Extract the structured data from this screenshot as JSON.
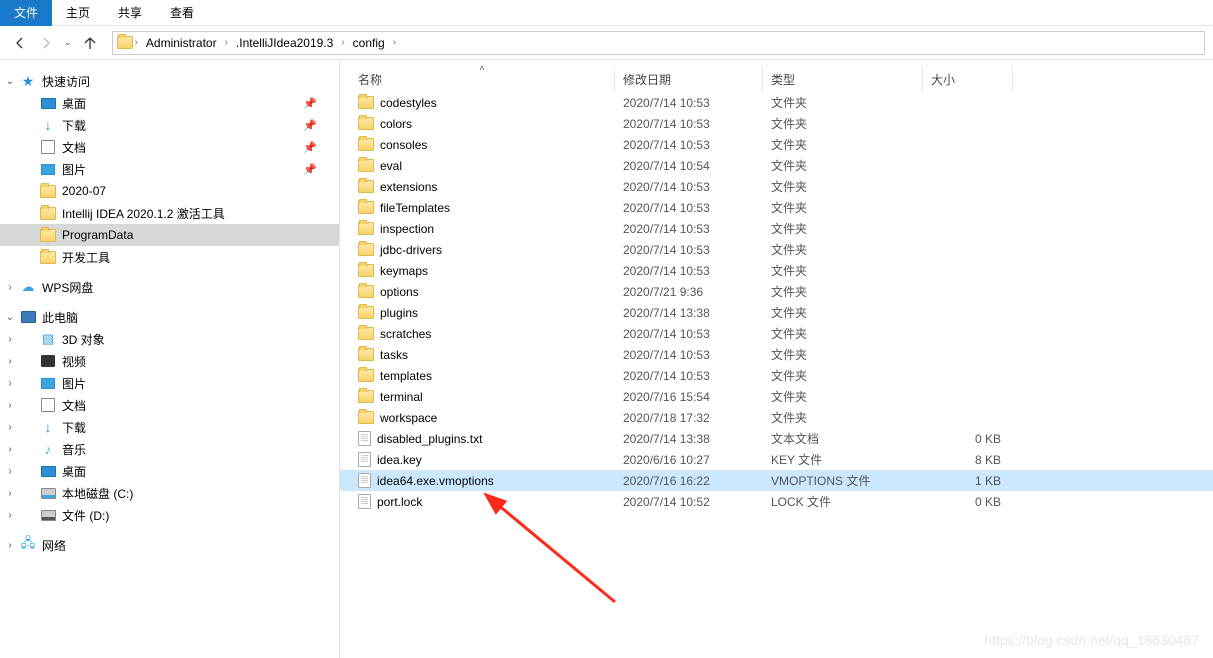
{
  "menu": {
    "file": "文件",
    "home": "主页",
    "share": "共享",
    "view": "查看"
  },
  "breadcrumb": [
    "Administrator",
    ".IntelliJIdea2019.3",
    "config"
  ],
  "sidebar": {
    "quick": "快速访问",
    "desktop": "桌面",
    "downloads": "下载",
    "documents": "文档",
    "pictures": "图片",
    "f_2020_07": "2020-07",
    "f_intellij": "Intellij IDEA 2020.1.2 激活工具",
    "f_programdata": "ProgramData",
    "f_devtools": "开发工具",
    "wps": "WPS网盘",
    "thispc": "此电脑",
    "obj3d": "3D 对象",
    "videos": "视频",
    "pictures2": "图片",
    "documents2": "文档",
    "downloads2": "下载",
    "music": "音乐",
    "desktop2": "桌面",
    "diskc": "本地磁盘 (C:)",
    "diskd": "文件 (D:)",
    "network": "网络"
  },
  "columns": {
    "name": "名称",
    "date": "修改日期",
    "type": "类型",
    "size": "大小"
  },
  "rows": [
    {
      "icon": "folder",
      "name": "codestyles",
      "date": "2020/7/14 10:53",
      "type": "文件夹",
      "size": ""
    },
    {
      "icon": "folder",
      "name": "colors",
      "date": "2020/7/14 10:53",
      "type": "文件夹",
      "size": ""
    },
    {
      "icon": "folder",
      "name": "consoles",
      "date": "2020/7/14 10:53",
      "type": "文件夹",
      "size": ""
    },
    {
      "icon": "folder",
      "name": "eval",
      "date": "2020/7/14 10:54",
      "type": "文件夹",
      "size": ""
    },
    {
      "icon": "folder",
      "name": "extensions",
      "date": "2020/7/14 10:53",
      "type": "文件夹",
      "size": ""
    },
    {
      "icon": "folder",
      "name": "fileTemplates",
      "date": "2020/7/14 10:53",
      "type": "文件夹",
      "size": ""
    },
    {
      "icon": "folder",
      "name": "inspection",
      "date": "2020/7/14 10:53",
      "type": "文件夹",
      "size": ""
    },
    {
      "icon": "folder",
      "name": "jdbc-drivers",
      "date": "2020/7/14 10:53",
      "type": "文件夹",
      "size": ""
    },
    {
      "icon": "folder",
      "name": "keymaps",
      "date": "2020/7/14 10:53",
      "type": "文件夹",
      "size": ""
    },
    {
      "icon": "folder",
      "name": "options",
      "date": "2020/7/21 9:36",
      "type": "文件夹",
      "size": ""
    },
    {
      "icon": "folder",
      "name": "plugins",
      "date": "2020/7/14 13:38",
      "type": "文件夹",
      "size": ""
    },
    {
      "icon": "folder",
      "name": "scratches",
      "date": "2020/7/14 10:53",
      "type": "文件夹",
      "size": ""
    },
    {
      "icon": "folder",
      "name": "tasks",
      "date": "2020/7/14 10:53",
      "type": "文件夹",
      "size": ""
    },
    {
      "icon": "folder",
      "name": "templates",
      "date": "2020/7/14 10:53",
      "type": "文件夹",
      "size": ""
    },
    {
      "icon": "folder",
      "name": "terminal",
      "date": "2020/7/16 15:54",
      "type": "文件夹",
      "size": ""
    },
    {
      "icon": "folder",
      "name": "workspace",
      "date": "2020/7/18 17:32",
      "type": "文件夹",
      "size": ""
    },
    {
      "icon": "file",
      "name": "disabled_plugins.txt",
      "date": "2020/7/14 13:38",
      "type": "文本文档",
      "size": "0 KB"
    },
    {
      "icon": "file",
      "name": "idea.key",
      "date": "2020/6/16 10:27",
      "type": "KEY 文件",
      "size": "8 KB"
    },
    {
      "icon": "file",
      "name": "idea64.exe.vmoptions",
      "date": "2020/7/16 16:22",
      "type": "VMOPTIONS 文件",
      "size": "1 KB",
      "selected": true
    },
    {
      "icon": "file",
      "name": "port.lock",
      "date": "2020/7/14 10:52",
      "type": "LOCK 文件",
      "size": "0 KB"
    }
  ],
  "watermark": "https://blog.csdn.net/qq_18630487"
}
